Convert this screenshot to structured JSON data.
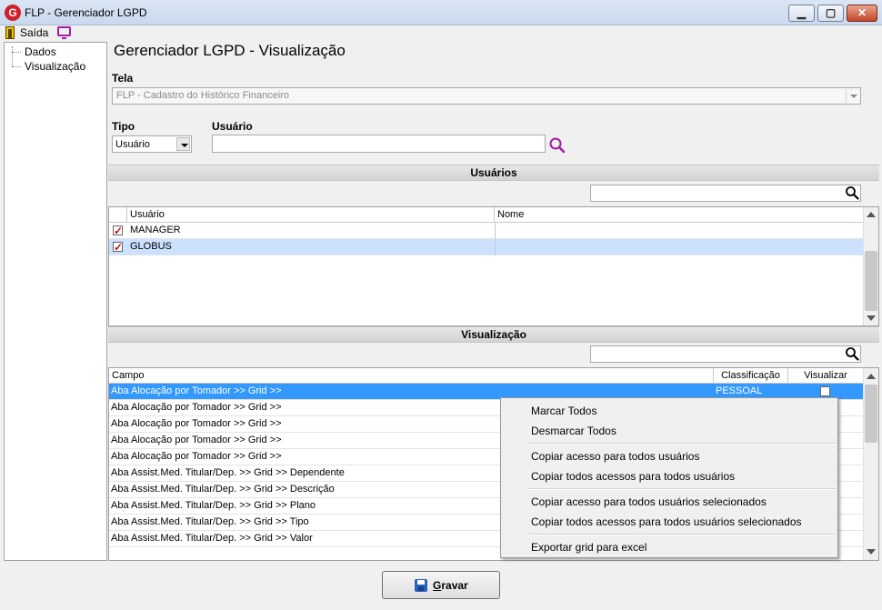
{
  "window": {
    "title": "FLP - Gerenciador LGPD",
    "logo_letter": "G",
    "min_glyph": "▁",
    "max_glyph": "▢",
    "close_glyph": "✕"
  },
  "menubar": {
    "exit_label": "Saída"
  },
  "tree": {
    "items": [
      "Dados",
      "Visualização"
    ]
  },
  "page": {
    "title": "Gerenciador LGPD - Visualização"
  },
  "tela": {
    "label": "Tela",
    "value": "FLP - Cadastro do Histórico Financeiro"
  },
  "tipo": {
    "label": "Tipo",
    "value": "Usuário"
  },
  "usuario": {
    "label": "Usuário",
    "value": ""
  },
  "usuarios_section": {
    "title": "Usuários",
    "filter_value": "",
    "columns": [
      "Usuário",
      "Nome"
    ],
    "rows": [
      {
        "usuario": "MANAGER",
        "nome": "",
        "checked": true
      },
      {
        "usuario": "GLOBUS",
        "nome": "",
        "checked": true
      }
    ]
  },
  "visualizacao_section": {
    "title": "Visualização",
    "filter_value": "",
    "columns": [
      "Campo",
      "Classificação",
      "Visualizar"
    ],
    "rows": [
      {
        "campo": "Aba Alocação por Tomador >> Grid >>",
        "classificacao": "PESSOAL"
      },
      {
        "campo": "Aba Alocação por Tomador >> Grid >>"
      },
      {
        "campo": "Aba Alocação por Tomador >> Grid >>"
      },
      {
        "campo": "Aba Alocação por Tomador >> Grid >>"
      },
      {
        "campo": "Aba Alocação por Tomador >> Grid >>"
      },
      {
        "campo": "Aba Assist.Med. Titular/Dep. >> Grid >> Dependente"
      },
      {
        "campo": "Aba Assist.Med. Titular/Dep. >> Grid >> Descrição"
      },
      {
        "campo": "Aba Assist.Med. Titular/Dep. >> Grid >> Plano"
      },
      {
        "campo": "Aba Assist.Med. Titular/Dep. >> Grid >> Tipo"
      },
      {
        "campo": "Aba Assist.Med. Titular/Dep. >> Grid >> Valor"
      }
    ]
  },
  "context_menu": {
    "items": [
      "Marcar Todos",
      "Desmarcar Todos",
      "Copiar acesso para todos usuários",
      "Copiar todos acessos para todos usuários",
      "Copiar acesso para todos usuários selecionados",
      "Copiar todos acessos para todos usuários selecionados",
      "Exportar grid para excel"
    ]
  },
  "footer": {
    "save_label": "Gravar"
  },
  "colors": {
    "selection": "#3399ff",
    "selection_light": "#cce0ff",
    "accent_icon": "#a21ca8",
    "logo": "#d0202a"
  }
}
